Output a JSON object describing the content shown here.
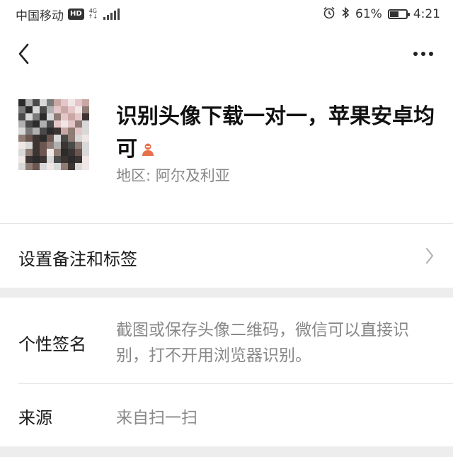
{
  "status_bar": {
    "carrier": "中国移动",
    "hd_badge": "HD",
    "network": "4G",
    "network_sub": "↑↓",
    "battery_percent": "61%",
    "battery_level": 0.61,
    "time": "4:21",
    "icons": [
      "alarm-icon",
      "bluetooth-icon",
      "battery-icon",
      "signal-icon"
    ]
  },
  "navbar": {
    "back_icon": "chevron-left-icon",
    "more_icon": "more-dots-icon"
  },
  "profile": {
    "name": "识别头像下载一对一，苹果安卓均可",
    "gender_icon": "person-female-icon",
    "gender_color": "#e8704a",
    "region_label": "地区:",
    "region_value": "阿尔及利亚"
  },
  "remark_row": {
    "label": "设置备注和标签"
  },
  "signature_row": {
    "label": "个性签名",
    "value": "截图或保存头像二维码，微信可以直接识别，打不开用浏览器识别。"
  },
  "source_row": {
    "label": "来源",
    "value": "来自扫一扫"
  },
  "colors": {
    "background": "#ffffff",
    "band": "#ededed",
    "secondary_text": "#888888",
    "primary_text": "#1a1a1a"
  }
}
